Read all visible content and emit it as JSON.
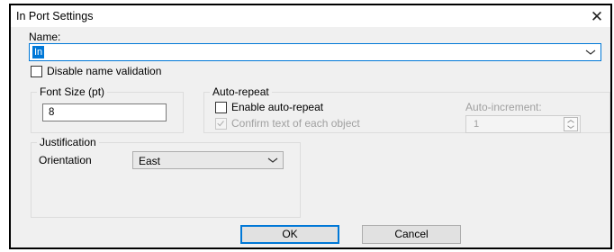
{
  "dialog": {
    "title": "In Port Settings",
    "close_glyph": "✕"
  },
  "name": {
    "label": "Name:",
    "value": "In"
  },
  "disable_validation": {
    "label": "Disable name validation",
    "checked": false
  },
  "font_size": {
    "group_title": "Font Size (pt)",
    "value": "8"
  },
  "auto_repeat": {
    "group_title": "Auto-repeat",
    "enable_label": "Enable auto-repeat",
    "enable_checked": false,
    "confirm_label": "Confirm text of each object",
    "confirm_checked": true,
    "confirm_enabled": false,
    "increment_label": "Auto-increment:",
    "increment_value": "1"
  },
  "justification": {
    "group_title": "Justification",
    "orientation_label": "Orientation",
    "orientation_value": "East"
  },
  "buttons": {
    "ok": "OK",
    "cancel": "Cancel"
  },
  "colors": {
    "accent": "#0078d7",
    "disabled_text": "#a0a0a0"
  },
  "icons": {
    "close": "close-icon",
    "dropdown": "chevron-down-icon",
    "spin": "spinner-arrows-icon",
    "check": "checkmark-icon"
  }
}
